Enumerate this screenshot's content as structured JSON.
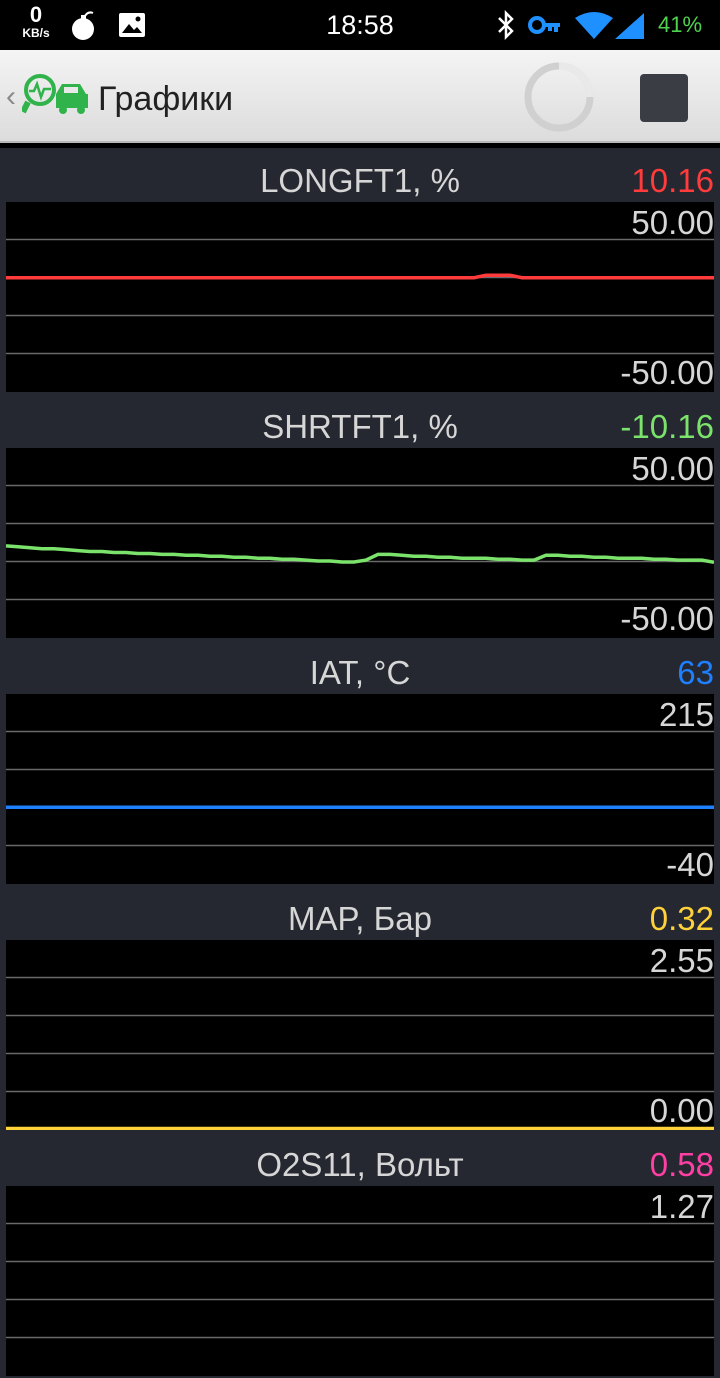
{
  "status_bar": {
    "speed_value": "0",
    "speed_unit": "KB/s",
    "time": "18:58",
    "battery": "41%"
  },
  "action_bar": {
    "back_glyph": "‹",
    "title": "Графики"
  },
  "colors": {
    "longft": "#ff3b3b",
    "shrtft": "#7be36b",
    "iat": "#1e7fff",
    "map": "#ffd23a",
    "o2s": "#ff3fa3"
  },
  "panels": [
    {
      "title": "LONGFT1, %",
      "value": "10.16",
      "ymax": "50.00",
      "ymin": "-50.00",
      "color": "#ff3b3b"
    },
    {
      "title": "SHRTFT1, %",
      "value": "-10.16",
      "ymax": "50.00",
      "ymin": "-50.00",
      "color": "#7be36b"
    },
    {
      "title": "IAT, °C",
      "value": "63",
      "ymax": "215",
      "ymin": "-40",
      "color": "#1e7fff"
    },
    {
      "title": "MAP, Бар",
      "value": "0.32",
      "ymax": "2.55",
      "ymin": "0.00",
      "color": "#ffd23a"
    },
    {
      "title": "O2S11, Вольт",
      "value": "0.58",
      "ymax": "1.27",
      "ymin": "",
      "color": "#ff3fa3"
    }
  ],
  "chart_data": [
    {
      "type": "line",
      "title": "LONGFT1, %",
      "ylim": [
        -50,
        50
      ],
      "grid": true,
      "series": [
        {
          "values": [
            10.16,
            10.16,
            10.16,
            10.16,
            10.16,
            10.16,
            10.16,
            10.16,
            10.16,
            10.16,
            10.16,
            10.16,
            10.16,
            10.16,
            10.16,
            10.16,
            10.16,
            10.16,
            10.16,
            10.16,
            10.16,
            10.16,
            10.16,
            10.16,
            10.16,
            10.16,
            10.16,
            10.16,
            10.16,
            10.16,
            10.16,
            10.16,
            10.16,
            10.16,
            10.16,
            10.16,
            10.16,
            10.16,
            10.16,
            10.16,
            11.5,
            11.5,
            11.5,
            10.16,
            10.16,
            10.16,
            10.16,
            10.16,
            10.16,
            10.16,
            10.16,
            10.16,
            10.16,
            10.16,
            10.16,
            10.16,
            10.16,
            10.16,
            10.16,
            10.16
          ]
        }
      ]
    },
    {
      "type": "line",
      "title": "SHRTFT1, %",
      "ylim": [
        -50,
        50
      ],
      "grid": true,
      "series": [
        {
          "values": [
            -1.5,
            -2,
            -2.5,
            -3,
            -3,
            -3.5,
            -4,
            -4.5,
            -4.5,
            -5,
            -5,
            -5.5,
            -5.5,
            -6,
            -6,
            -6.5,
            -6.5,
            -7,
            -7,
            -7.5,
            -7.5,
            -8,
            -8,
            -8.5,
            -8.5,
            -9,
            -9.5,
            -9.5,
            -10,
            -10,
            -9,
            -6,
            -6,
            -6.5,
            -7,
            -7,
            -7.5,
            -7.5,
            -8,
            -8,
            -8,
            -8.5,
            -8.5,
            -9,
            -9,
            -6.5,
            -6.5,
            -7,
            -7,
            -7.5,
            -7.5,
            -8,
            -8,
            -8,
            -8.5,
            -8.5,
            -9,
            -9,
            -9,
            -10.16
          ]
        }
      ]
    },
    {
      "type": "line",
      "title": "IAT, °C",
      "ylim": [
        -40,
        215
      ],
      "grid": true,
      "series": [
        {
          "values": [
            63,
            63,
            63,
            63,
            63,
            63,
            63,
            63,
            63,
            63,
            63,
            63,
            63,
            63,
            63,
            63,
            63,
            63,
            63,
            63,
            63,
            63,
            63,
            63,
            63,
            63,
            63,
            63,
            63,
            63,
            63,
            63,
            63,
            63,
            63,
            63,
            63,
            63,
            63,
            63,
            63,
            63,
            63,
            63,
            63,
            63,
            63,
            63,
            63,
            63,
            63,
            63,
            63,
            63,
            63,
            63,
            63,
            63,
            63,
            63
          ]
        }
      ]
    },
    {
      "type": "line",
      "title": "MAP, Бар",
      "ylim": [
        0,
        2.55
      ],
      "grid": true,
      "series": [
        {
          "values": [
            0.02,
            0.02,
            0.02,
            0.02,
            0.02,
            0.02,
            0.02,
            0.02,
            0.02,
            0.02,
            0.02,
            0.02,
            0.02,
            0.02,
            0.02,
            0.02,
            0.02,
            0.02,
            0.02,
            0.02,
            0.02,
            0.02,
            0.02,
            0.02,
            0.02,
            0.02,
            0.02,
            0.02,
            0.02,
            0.02,
            0.02,
            0.02,
            0.02,
            0.02,
            0.02,
            0.02,
            0.02,
            0.02,
            0.02,
            0.02,
            0.02,
            0.02,
            0.02,
            0.02,
            0.02,
            0.02,
            0.02,
            0.02,
            0.02,
            0.02,
            0.02,
            0.02,
            0.02,
            0.02,
            0.02,
            0.02,
            0.02,
            0.02,
            0.02,
            0.02
          ]
        }
      ]
    },
    {
      "type": "line",
      "title": "O2S11, Вольт",
      "ylim": [
        0,
        1.27
      ],
      "grid": true,
      "series": [
        {
          "values": []
        }
      ]
    }
  ]
}
